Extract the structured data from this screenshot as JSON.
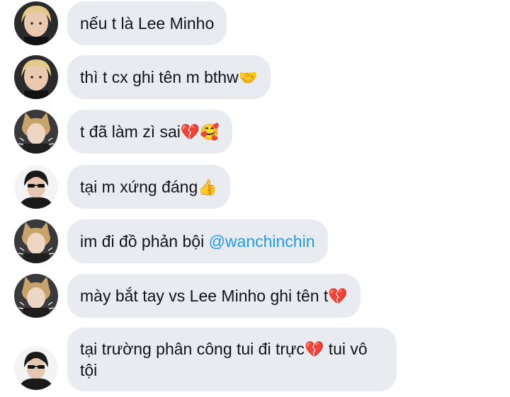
{
  "messages": [
    {
      "avatar": "blonde-boy-avatar",
      "text": "nếu t là Lee Minho",
      "emoji": ""
    },
    {
      "avatar": "blonde-boy-avatar",
      "text": "thì t cx ghi tên m bthw",
      "emoji": "🤝"
    },
    {
      "avatar": "cat-ear-girl-avatar",
      "text": "t đã làm zì sai",
      "emoji": "💔🥰"
    },
    {
      "avatar": "sunglasses-boy-avatar",
      "text": "tại m xứng đáng",
      "emoji": "👍"
    },
    {
      "avatar": "cat-ear-girl-avatar",
      "text": "im đi đồ phản bội ",
      "mention": "@wanchinchin"
    },
    {
      "avatar": "cat-ear-girl-avatar",
      "text": "mày bắt tay vs Lee Minho ghi tên t",
      "emoji": "💔"
    },
    {
      "avatar": "sunglasses-boy-avatar",
      "text": "tại trường phân công tui đi trực",
      "emoji": "💔",
      "text2": " tui vô tội"
    }
  ],
  "colors": {
    "bubble": "#e8ecf0",
    "text": "#111418",
    "mention": "#1d9bf0"
  }
}
